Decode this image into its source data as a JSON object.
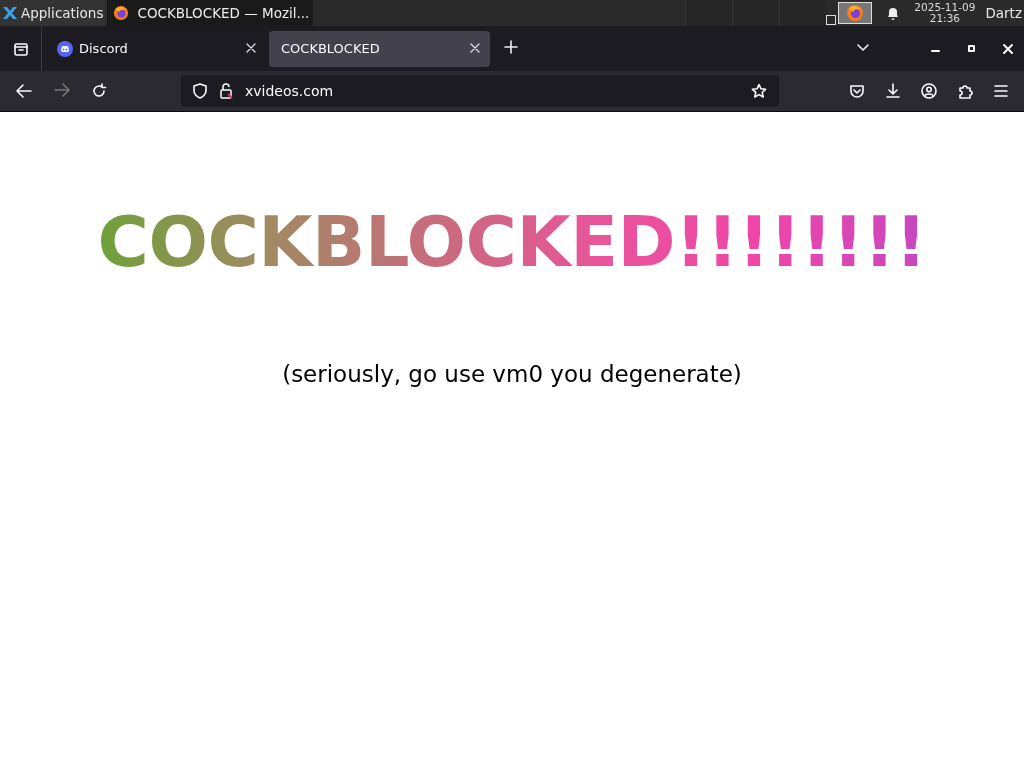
{
  "panel": {
    "apps_label": "Applications",
    "task_title": "COCKBLOCKED — Mozil...",
    "clock": {
      "date": "2025-11-09",
      "time": "21:36"
    },
    "user": "Dartz"
  },
  "tabs": [
    {
      "label": "Discord",
      "selected": false,
      "favicon": true
    },
    {
      "label": "COCKBLOCKED",
      "selected": true,
      "favicon": false
    }
  ],
  "address": {
    "url": "xvideos.com"
  },
  "page": {
    "heading": "COCKBLOCKED!!!!!!!!",
    "subtitle": "(seriously, go use vm0 you degenerate)"
  }
}
